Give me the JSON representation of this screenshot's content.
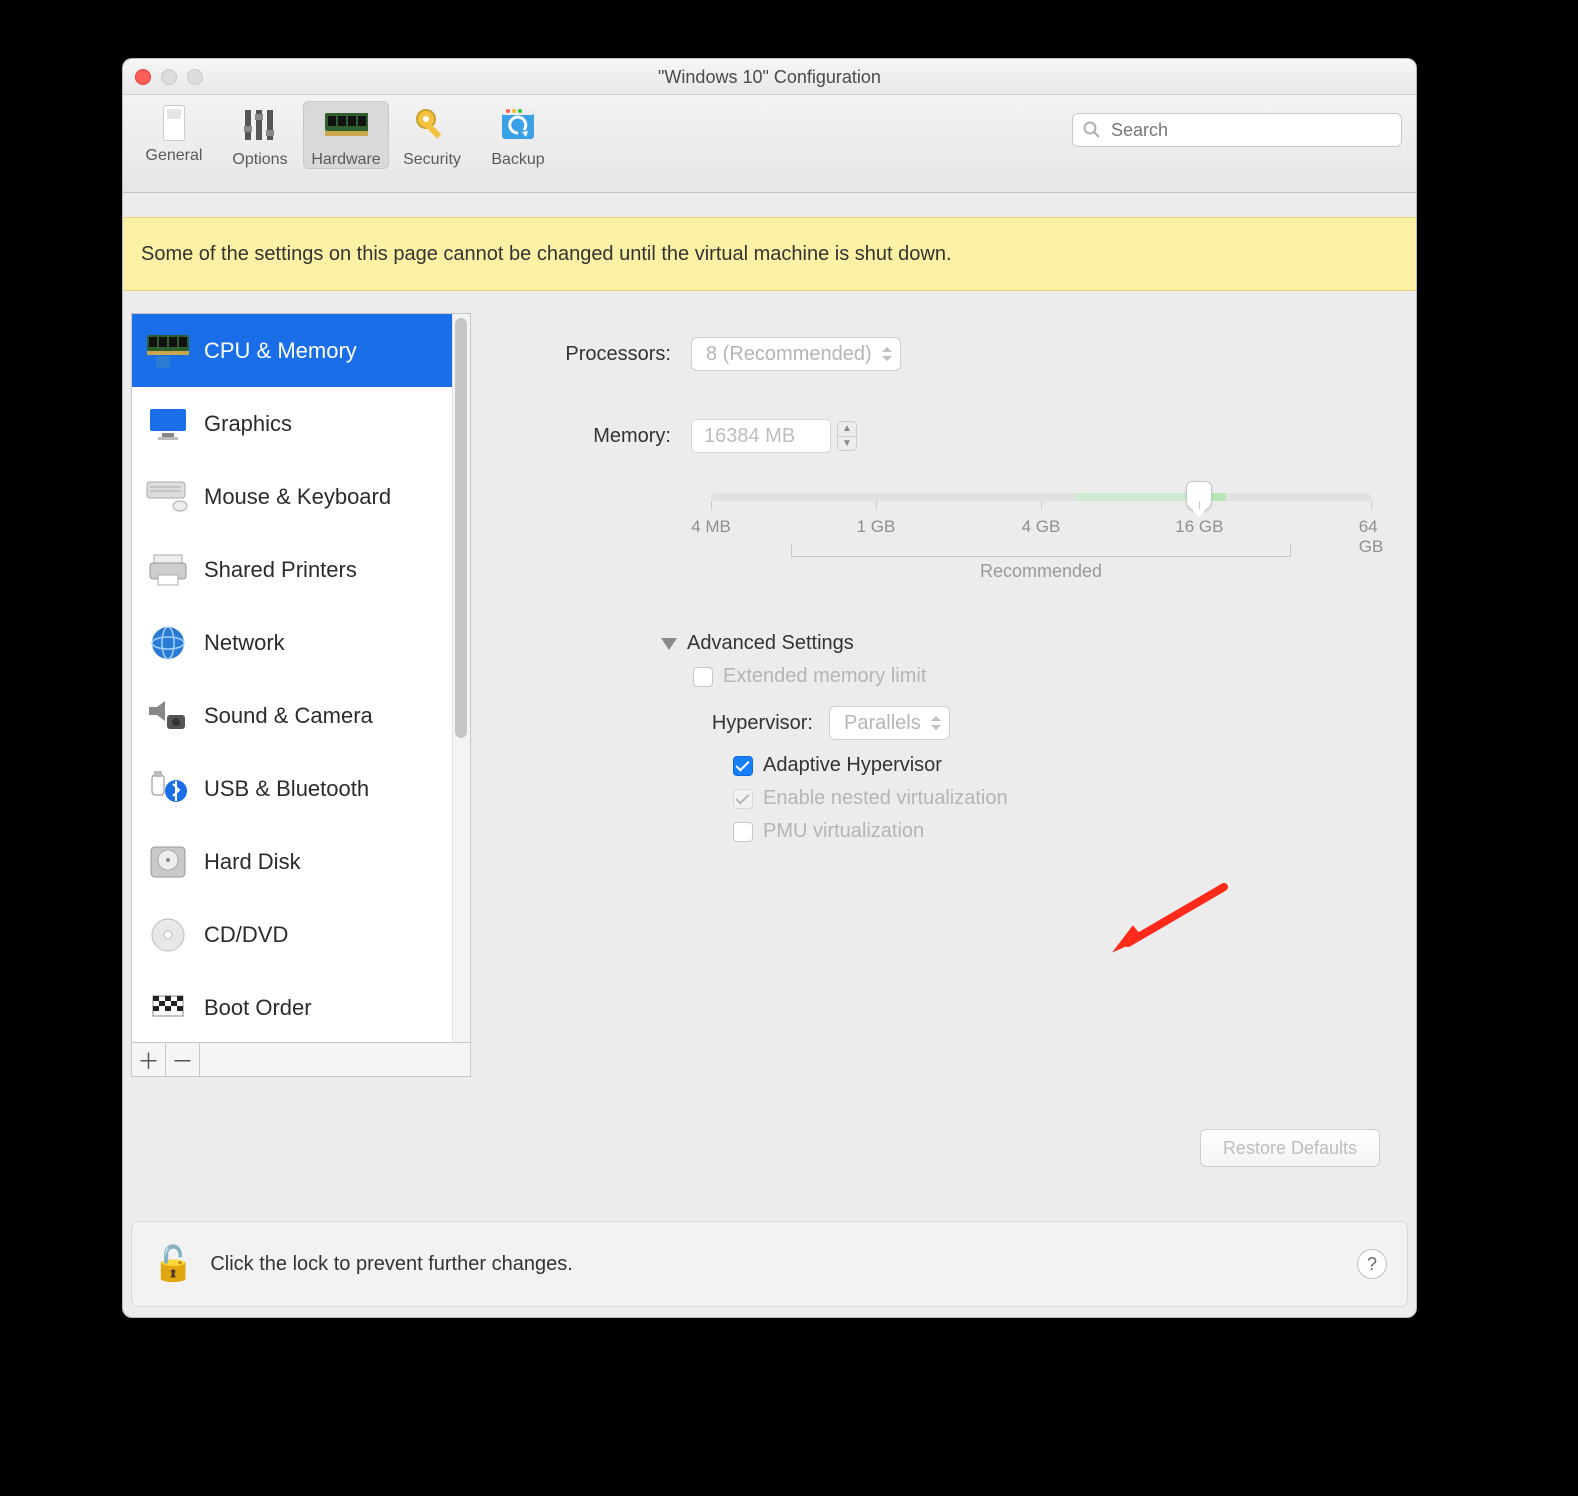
{
  "window": {
    "title": "\"Windows 10\" Configuration"
  },
  "toolbar": {
    "items": [
      {
        "label": "General"
      },
      {
        "label": "Options"
      },
      {
        "label": "Hardware"
      },
      {
        "label": "Security"
      },
      {
        "label": "Backup"
      }
    ],
    "search_placeholder": "Search"
  },
  "warning": "Some of the settings on this page cannot be changed until the virtual machine is shut down.",
  "sidebar": {
    "items": [
      {
        "label": "CPU & Memory"
      },
      {
        "label": "Graphics"
      },
      {
        "label": "Mouse & Keyboard"
      },
      {
        "label": "Shared Printers"
      },
      {
        "label": "Network"
      },
      {
        "label": "Sound & Camera"
      },
      {
        "label": "USB & Bluetooth"
      },
      {
        "label": "Hard Disk"
      },
      {
        "label": "CD/DVD"
      },
      {
        "label": "Boot Order"
      }
    ]
  },
  "pane": {
    "processors_label": "Processors:",
    "processors_value": "8 (Recommended)",
    "memory_label": "Memory:",
    "memory_value": "16384 MB",
    "slider_ticks": [
      "4 MB",
      "1 GB",
      "4 GB",
      "16 GB",
      "64 GB"
    ],
    "recommended": "Recommended",
    "advanced_title": "Advanced Settings",
    "ext_mem": "Extended memory limit",
    "hypervisor_label": "Hypervisor:",
    "hypervisor_value": "Parallels",
    "adaptive": "Adaptive Hypervisor",
    "nested": "Enable nested virtualization",
    "pmu": "PMU virtualization",
    "restore": "Restore Defaults"
  },
  "footer": {
    "text": "Click the lock to prevent further changes."
  }
}
